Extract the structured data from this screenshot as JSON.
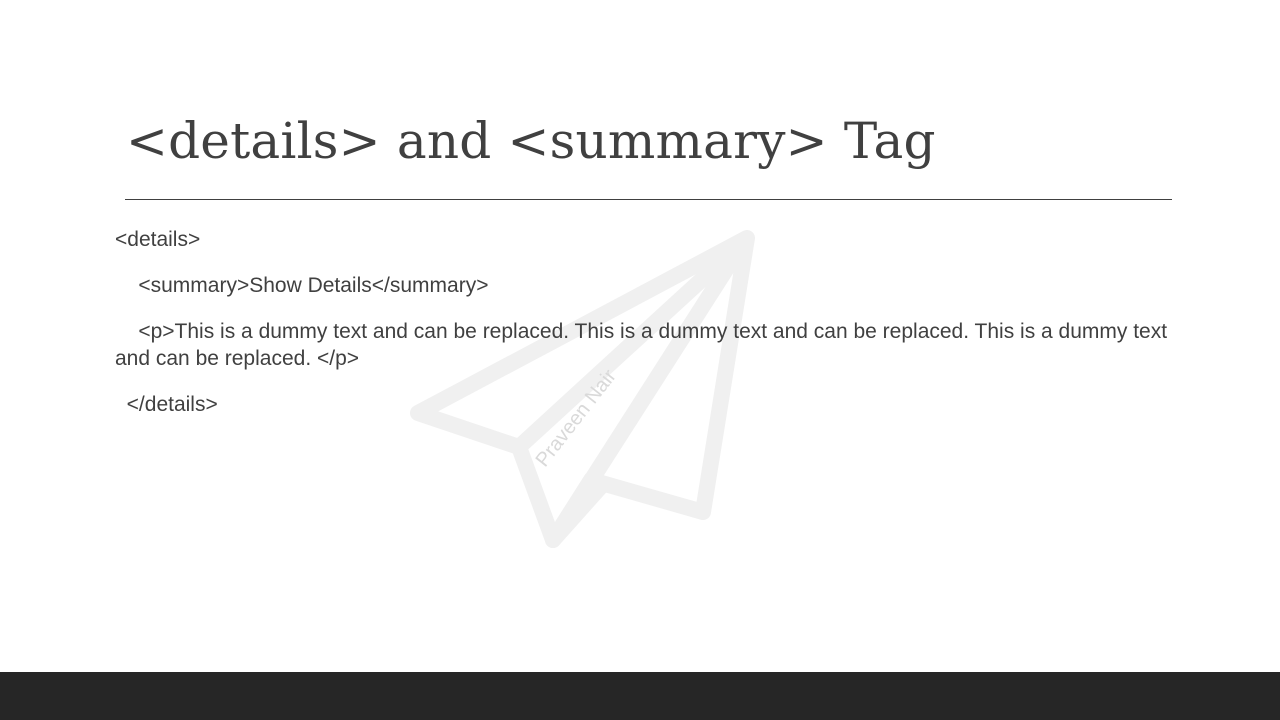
{
  "slide": {
    "title": "<details> and <summary> Tag",
    "code_lines": [
      "<details>",
      "    <summary>Show Details</summary>",
      "    <p>This is a dummy text and can be replaced. This is a dummy text and can be replaced. This is a dummy text and can be replaced. </p>",
      "  </details>"
    ],
    "watermark_text": "Praveen Nair"
  },
  "colors": {
    "text": "#404040",
    "footer": "#262626",
    "watermark": "#f0f0f0"
  }
}
